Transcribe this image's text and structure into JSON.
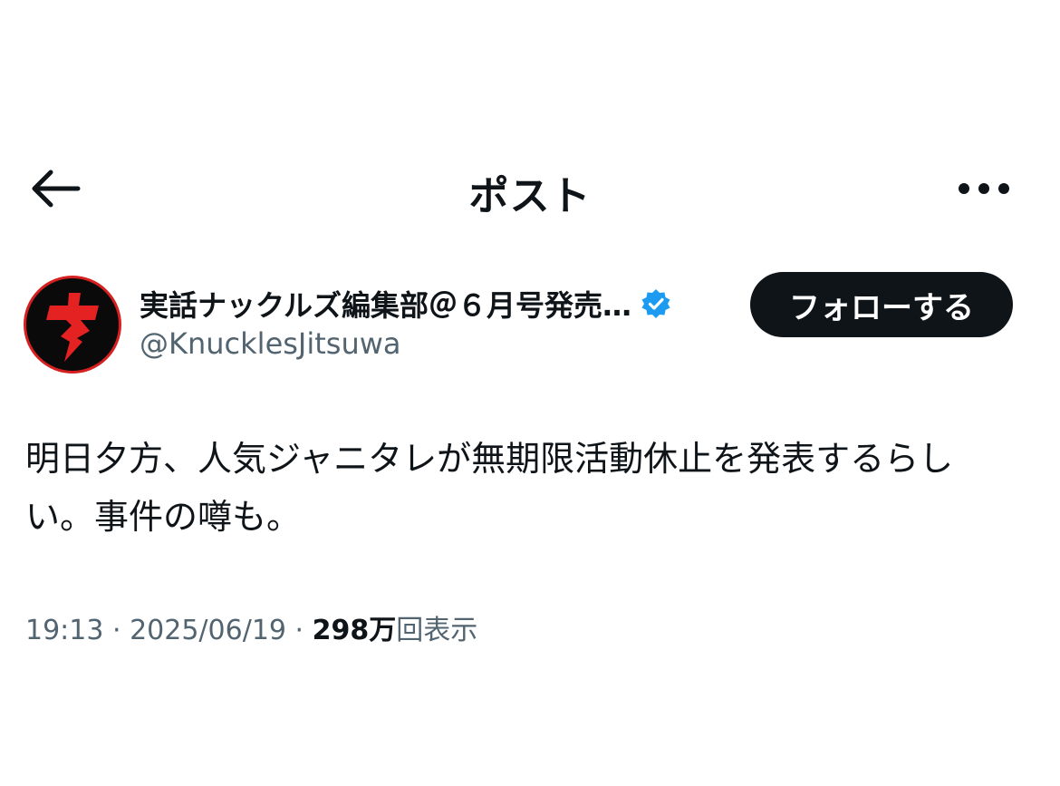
{
  "header": {
    "title": "ポスト"
  },
  "icons": {
    "back": "arrow-left-icon",
    "more": "more-horizontal-icon",
    "verified": "verified-badge-icon"
  },
  "author": {
    "display_name": "実話ナックルズ編集部＠６月号発売…",
    "handle": "@KnucklesJitsuwa",
    "follow_label": "フォローする"
  },
  "post": {
    "text": "明日夕方、人気ジャニタレが無期限活動休止を発表するらしい。事件の噂も。"
  },
  "meta": {
    "time": "19:13",
    "separator1": " · ",
    "date": "2025/06/19",
    "separator2": " · ",
    "views_count": "298万",
    "views_label": "回表示"
  },
  "colors": {
    "text_primary": "#0f1419",
    "text_secondary": "#536471",
    "verified_blue": "#1d9bf0",
    "follow_button_bg": "#0f1419",
    "avatar_red": "#d62020"
  }
}
